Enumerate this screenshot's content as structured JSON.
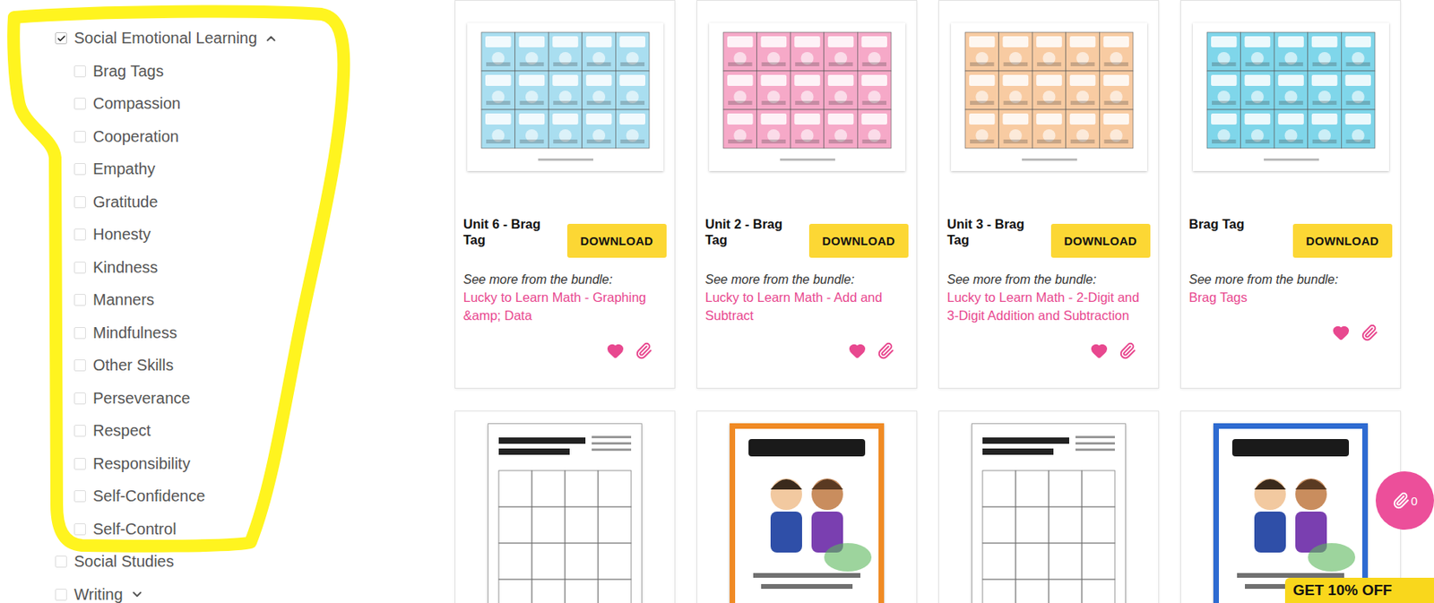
{
  "filters": {
    "groups": [
      {
        "label": "Social Emotional Learning",
        "checked": true,
        "expanded": true,
        "items": [
          {
            "label": "Brag Tags",
            "checked": false
          },
          {
            "label": "Compassion",
            "checked": false
          },
          {
            "label": "Cooperation",
            "checked": false
          },
          {
            "label": "Empathy",
            "checked": false
          },
          {
            "label": "Gratitude",
            "checked": false
          },
          {
            "label": "Honesty",
            "checked": false
          },
          {
            "label": "Kindness",
            "checked": false
          },
          {
            "label": "Manners",
            "checked": false
          },
          {
            "label": "Mindfulness",
            "checked": false
          },
          {
            "label": "Other Skills",
            "checked": false
          },
          {
            "label": "Perseverance",
            "checked": false
          },
          {
            "label": "Respect",
            "checked": false
          },
          {
            "label": "Responsibility",
            "checked": false
          },
          {
            "label": "Self-Confidence",
            "checked": false
          },
          {
            "label": "Self-Control",
            "checked": false
          }
        ]
      },
      {
        "label": "Social Studies",
        "checked": false
      },
      {
        "label": "Writing",
        "checked": false,
        "expanded": false
      }
    ]
  },
  "products": [
    {
      "title": "Unit 6 - Brag Tag",
      "button": "DOWNLOAD",
      "bundle_label": "See more from the bundle:",
      "bundle": "Lucky to Learn Math - Graphing &amp; Data",
      "favorited": true,
      "thumbnail": {
        "kind": "tags",
        "color": "#a9def0"
      }
    },
    {
      "title": "Unit 2 - Brag Tag",
      "button": "DOWNLOAD",
      "bundle_label": "See more from the bundle:",
      "bundle": "Lucky to Learn Math - Add and Subtract",
      "favorited": true,
      "thumbnail": {
        "kind": "tags",
        "color": "#f6a9c8"
      }
    },
    {
      "title": "Unit 3 - Brag Tag",
      "button": "DOWNLOAD",
      "bundle_label": "See more from the bundle:",
      "bundle": "Lucky to Learn Math - 2-Digit and 3-Digit Addition and Subtraction",
      "favorited": true,
      "thumbnail": {
        "kind": "tags",
        "color": "#f8cba2"
      }
    },
    {
      "title": "Brag Tag",
      "button": "DOWNLOAD",
      "bundle_label": "See more from the bundle:",
      "bundle": "Brag Tags",
      "favorited": true,
      "thumbnail": {
        "kind": "tags",
        "color": "#7fd6ea"
      }
    },
    {
      "thumbnail": {
        "kind": "worksheet"
      }
    },
    {
      "thumbnail": {
        "kind": "poster",
        "color": "#f08a24"
      }
    },
    {
      "thumbnail": {
        "kind": "worksheet"
      }
    },
    {
      "thumbnail": {
        "kind": "poster",
        "color": "#2e6bd1"
      }
    }
  ],
  "clip_badge": {
    "count": "0"
  },
  "promo": {
    "label": "GET 10% OFF"
  }
}
